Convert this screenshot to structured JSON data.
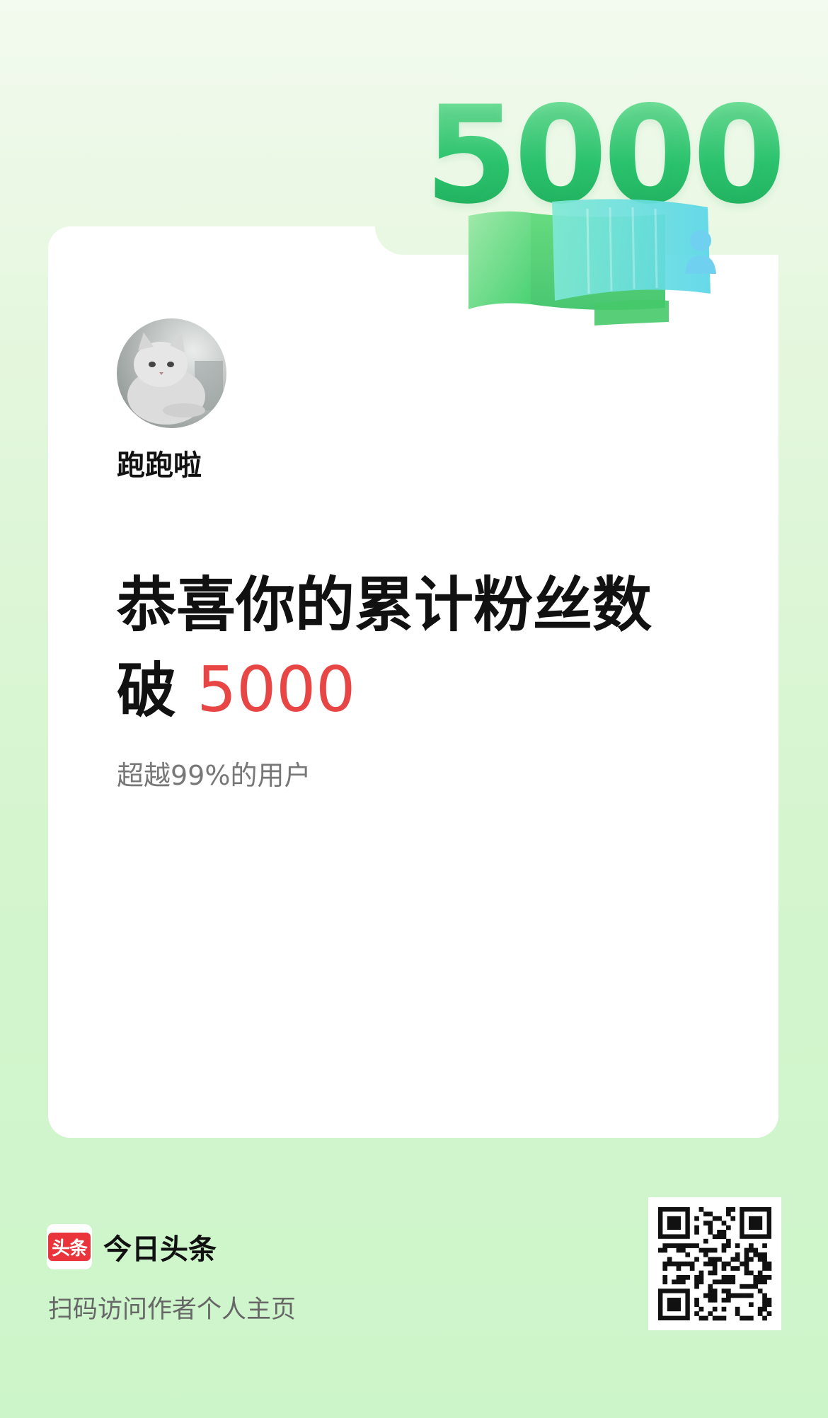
{
  "milestone": {
    "badge_number": "5000"
  },
  "profile": {
    "username": "跑跑啦",
    "avatar_icon": "cat-avatar-icon"
  },
  "headline": {
    "line1": "恭喜你的累计粉丝数",
    "line2_prefix": "破",
    "line2_number": "5000",
    "number_color": "#e84545"
  },
  "subline": "超越99%的用户",
  "footer": {
    "logo_text": "头条",
    "brand_name": "今日头条",
    "note": "扫码访问作者个人主页",
    "logo_color": "#e8343a"
  },
  "colors": {
    "badge_green": "#2cc770",
    "background": "#d4f5ce"
  }
}
